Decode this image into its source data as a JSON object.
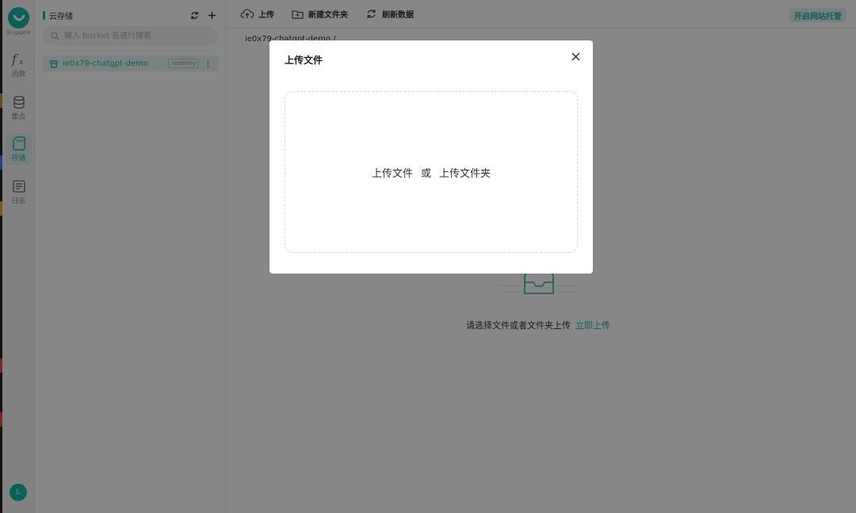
{
  "rail": {
    "region": "Singapore",
    "items": [
      {
        "icon": "function-icon",
        "label": "函数"
      },
      {
        "icon": "database-icon",
        "label": "集合"
      },
      {
        "icon": "storage-icon",
        "label": "存储"
      },
      {
        "icon": "log-icon",
        "label": "日志"
      }
    ],
    "avatar_initial": "L"
  },
  "panel": {
    "title": "云存储",
    "search_placeholder": "输入 bucket 名进行搜索",
    "bucket": {
      "name": "ie0x79-chatgpt-demo",
      "badge": "readonly"
    }
  },
  "toolbar": {
    "upload": "上传",
    "new_folder": "新建文件夹",
    "refresh": "刷新数据",
    "host_button": "开启网站托管"
  },
  "main": {
    "breadcrumb": "ie0x79-chatgpt-demo  /",
    "empty_text": "请选择文件或者文件夹上传",
    "empty_link": "立即上传"
  },
  "modal": {
    "title": "上传文件",
    "upload_file": "上传文件",
    "or": "或",
    "upload_folder": "上传文件夹"
  },
  "colors": {
    "accent": "#14b8a6",
    "overlay": "rgba(0,0,0,0.47)"
  }
}
